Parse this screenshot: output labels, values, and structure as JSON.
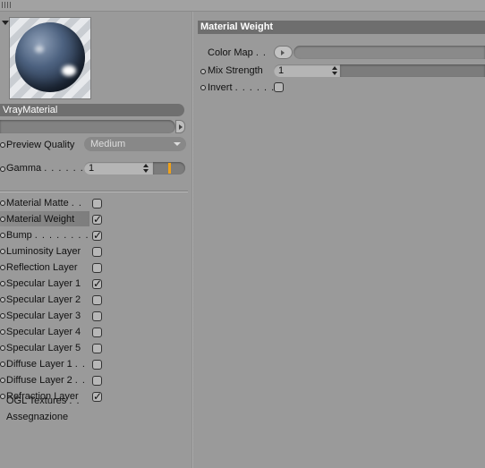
{
  "material": {
    "name": "VrayMaterial",
    "preview_quality_label": "Preview Quality",
    "preview_quality_value": "Medium",
    "gamma_label": "Gamma",
    "gamma_dots": ". . . . . . .",
    "gamma_value": "1"
  },
  "layers": [
    {
      "label": "Material Matte",
      "dots": ". .",
      "checked": false
    },
    {
      "label": "Material Weight",
      "dots": "",
      "checked": true
    },
    {
      "label": "Bump",
      "dots": ". . . . . . . . .",
      "checked": true
    },
    {
      "label": "Luminosity Layer",
      "dots": "",
      "checked": false
    },
    {
      "label": "Reflection Layer",
      "dots": "",
      "checked": false
    },
    {
      "label": "Specular Layer 1",
      "dots": "",
      "checked": true
    },
    {
      "label": "Specular Layer 2",
      "dots": "",
      "checked": false
    },
    {
      "label": "Specular Layer 3",
      "dots": "",
      "checked": false
    },
    {
      "label": "Specular Layer 4",
      "dots": "",
      "checked": false
    },
    {
      "label": "Specular Layer 5",
      "dots": "",
      "checked": false
    },
    {
      "label": "Diffuse Layer 1",
      "dots": ". .",
      "checked": false
    },
    {
      "label": "Diffuse Layer 2",
      "dots": ". .",
      "checked": false
    },
    {
      "label": "Refraction Layer",
      "dots": "",
      "checked": true
    }
  ],
  "extras": {
    "ogl_textures": "OGL Textures",
    "ogl_dots": ". .",
    "assegnazione": "Assegnazione"
  },
  "panel": {
    "title": "Material Weight",
    "color_map_label": "Color Map",
    "color_map_dots": ". .",
    "mix_strength_label": "Mix Strength",
    "mix_strength_value": "1",
    "invert_label": "Invert",
    "invert_dots": ". . . . . .",
    "invert_checked": false
  },
  "colors": {
    "background": "#9a9a9a",
    "header": "#6e6e6e",
    "slider_marker": "#f0a21a"
  }
}
